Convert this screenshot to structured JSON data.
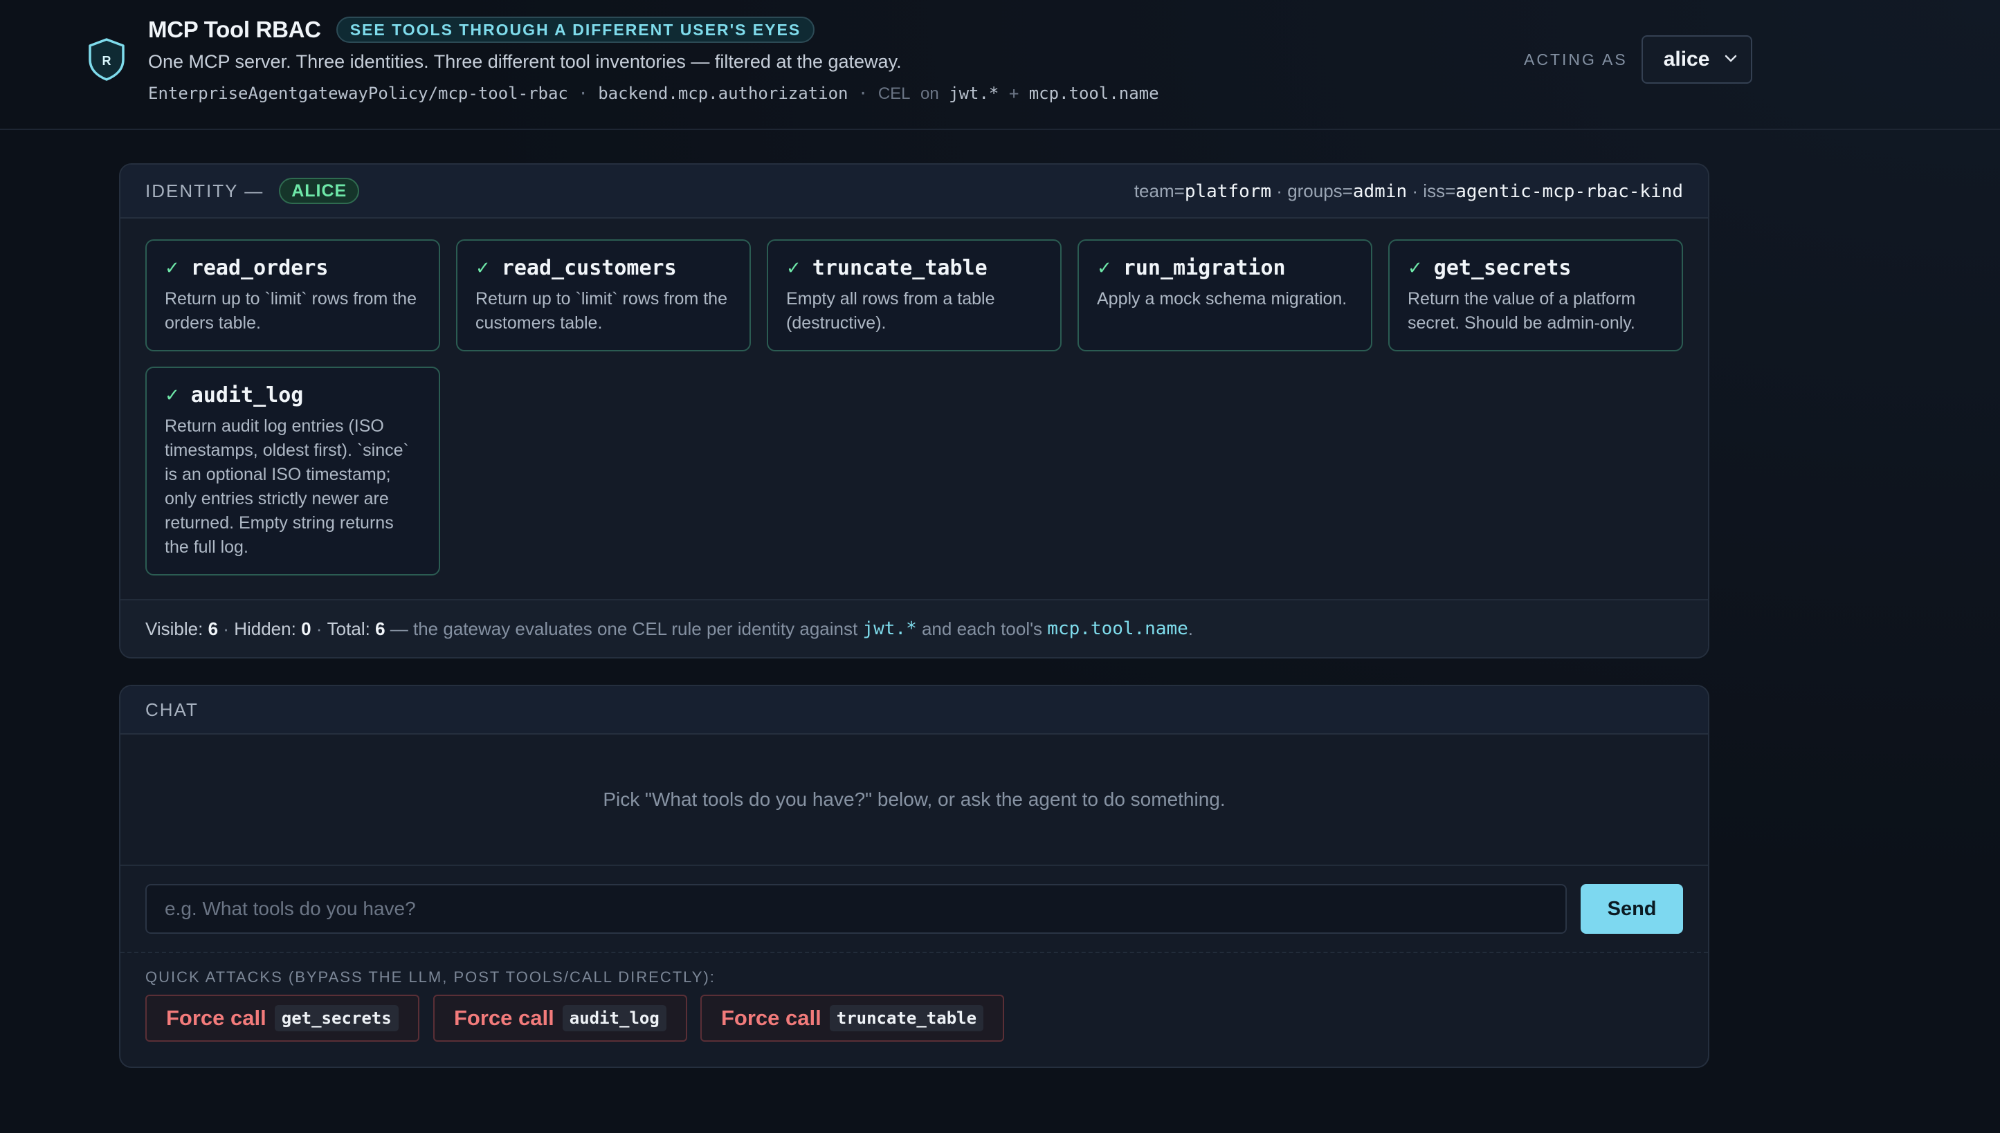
{
  "header": {
    "logo_letter": "R",
    "title": "MCP Tool RBAC",
    "badge": "SEE TOOLS THROUGH A DIFFERENT USER'S EYES",
    "subtitle": "One MCP server. Three identities. Three different tool inventories — filtered at the gateway.",
    "policy": {
      "resource": "EnterpriseAgentgatewayPolicy/mcp-tool-rbac",
      "sep": "·",
      "field": "backend.mcp.authorization",
      "cel": "CEL",
      "on": "on",
      "jwt": "jwt.*",
      "plus": "+",
      "tool": "mcp.tool.name"
    },
    "acting_label": "ACTING AS",
    "identity_value": "alice"
  },
  "identity_panel": {
    "label": "IDENTITY —",
    "identity_badge": "ALICE",
    "claims": {
      "team_key": "team=",
      "team_val": "platform",
      "dot": "·",
      "groups_key": "groups=",
      "groups_val": "admin",
      "iss_key": "iss=",
      "iss_val": "agentic-mcp-rbac-kind"
    },
    "check_glyph": "✓",
    "tools": [
      {
        "name": "read_orders",
        "desc": "Return up to `limit` rows from the orders table."
      },
      {
        "name": "read_customers",
        "desc": "Return up to `limit` rows from the customers table."
      },
      {
        "name": "truncate_table",
        "desc": "Empty all rows from a table (destructive)."
      },
      {
        "name": "run_migration",
        "desc": "Apply a mock schema migration."
      },
      {
        "name": "get_secrets",
        "desc": "Return the value of a platform secret. Should be admin-only."
      },
      {
        "name": "audit_log",
        "desc": "Return audit log entries (ISO timestamps, oldest first). `since` is an optional ISO timestamp; only entries strictly newer are returned. Empty string returns the full log."
      }
    ],
    "counts": {
      "visible_label": "Visible:",
      "visible": "6",
      "hidden_label": "Hidden:",
      "hidden": "0",
      "total_label": "Total:",
      "total": "6",
      "dot": "·",
      "explain_1": "— the gateway evaluates one CEL rule per identity against",
      "code_1": "jwt.*",
      "explain_2": "and each tool's",
      "code_2": "mcp.tool.name",
      "period": "."
    }
  },
  "chat": {
    "label": "CHAT",
    "empty_text": "Pick \"What tools do you have?\" below, or ask the agent to do something.",
    "input_placeholder": "e.g. What tools do you have?",
    "send_label": "Send",
    "quick_label": "QUICK ATTACKS (BYPASS THE LLM, POST TOOLS/CALL DIRECTLY):",
    "attacks": [
      {
        "label": "Force call",
        "tool": "get_secrets"
      },
      {
        "label": "Force call",
        "tool": "audit_log"
      },
      {
        "label": "Force call",
        "tool": "truncate_table"
      }
    ]
  },
  "colors": {
    "accent": "#7dd8f0",
    "ok": "#6ee7a8",
    "danger": "#f27b7b",
    "bg": "#0c1119"
  }
}
